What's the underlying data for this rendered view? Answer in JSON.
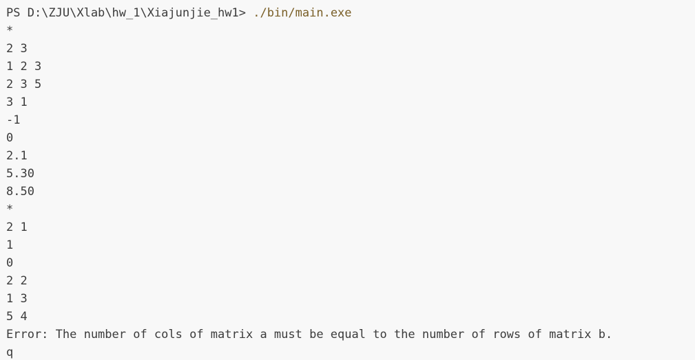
{
  "terminal": {
    "prompt": "PS D:\\ZJU\\Xlab\\hw_1\\Xiajunjie_hw1> ",
    "command": "./bin/main.exe",
    "output": [
      "*",
      "2 3",
      "1 2 3",
      "2 3 5",
      "3 1",
      "-1",
      "0",
      "2.1",
      "5.30",
      "8.50",
      "*",
      "2 1",
      "1",
      "0",
      "2 2",
      "1 3",
      "5 4",
      "Error: The number of cols of matrix a must be equal to the number of rows of matrix b.",
      "q"
    ]
  },
  "colors": {
    "background": "#f8f8f8",
    "text": "#3b3b3b",
    "command": "#795e26"
  }
}
